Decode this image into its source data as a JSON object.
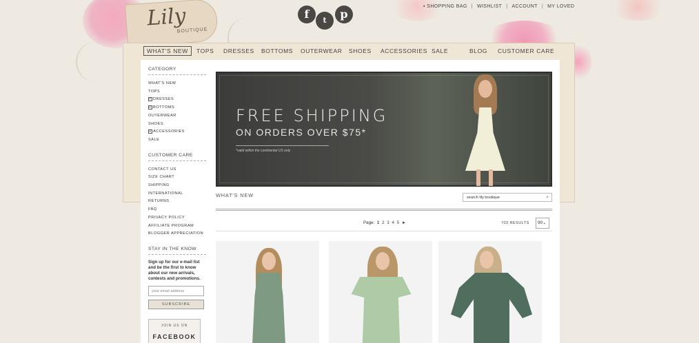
{
  "brand": {
    "logo_text": "Lily",
    "logo_sub": "BOUTIQUE"
  },
  "social": {
    "facebook": "f",
    "twitter": "t",
    "pinterest": "p"
  },
  "toplinks": {
    "bag": "SHOPPING BAG",
    "wishlist": "WISHLIST",
    "account": "ACCOUNT",
    "loved": "MY LOVED",
    "separator": "|"
  },
  "nav": [
    "WHAT'S NEW",
    "TOPS",
    "DRESSES",
    "BOTTOMS",
    "OUTERWEAR",
    "SHOES",
    "ACCESSORIES",
    "SALE",
    "BLOG",
    "CUSTOMER CARE"
  ],
  "sidebar": {
    "category_title": "CATEGORY",
    "categories": [
      "WHAT'S NEW",
      "TOPS",
      "DRESSES",
      "BOTTOMS",
      "OUTERWEAR",
      "SHOES",
      "ACCESSORIES",
      "SALE"
    ],
    "care_title": "CUSTOMER CARE",
    "care": [
      "CONTACT US",
      "SIZE CHART",
      "SHIPPING",
      "INTERNATIONAL",
      "RETURNS",
      "FAQ",
      "PRIVACY POLICY",
      "AFFILIATE PROGRAM",
      "BLOGGER APPRECIATION"
    ],
    "newsletter_title": "STAY IN THE KNOW",
    "newsletter_desc": "Sign up for our e-mail list and be the first to know about our new arrivals, contests and promotions.",
    "email_placeholder": "your email address",
    "subscribe": "SUBSCRIBE",
    "fb_join": "JOIN US ON",
    "fb_name": "FACEBOOK"
  },
  "banner": {
    "title": "FREE SHIPPING",
    "subtitle": "ON ORDERS OVER $75*",
    "note": "*valid within the continental US only"
  },
  "listing": {
    "title": "WHAT'S NEW",
    "search_value": "search lily boutique",
    "page_label": "Page:",
    "pages": [
      "1",
      "2",
      "3",
      "4",
      "5"
    ],
    "next": "►",
    "results": "703 RESULTS",
    "per_page": "90"
  },
  "colors": {
    "background": "#eeeae2",
    "accent_pink": "#f1a3bb",
    "product_green_1": "#7d9a80",
    "product_green_2": "#a9c9a1",
    "product_green_3": "#4f6e5c"
  }
}
